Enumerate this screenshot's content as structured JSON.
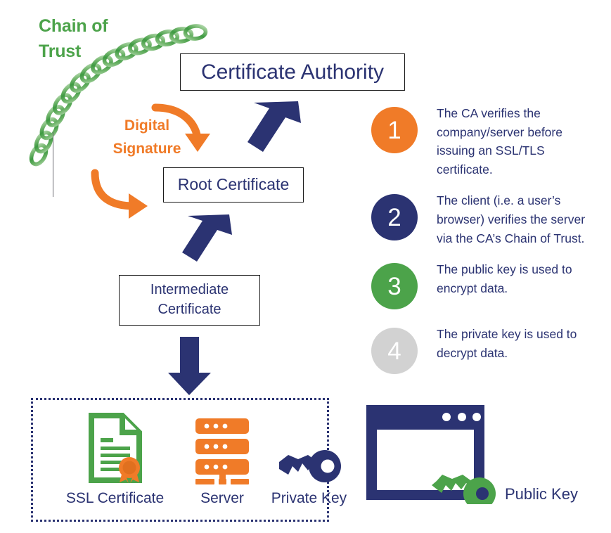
{
  "colors": {
    "navy": "#2B3372",
    "orange": "#F07B28",
    "green": "#4CA34A",
    "gray": "#D2D2D2",
    "white": "#FFFFFF",
    "box_border": "#1A1A1A",
    "rule": "#6B6B72"
  },
  "chain": {
    "label_line1": "Chain of",
    "label_line2": "Trust",
    "icon": "chain-links-icon"
  },
  "digital_signature": {
    "label_line1": "Digital",
    "label_line2": "Signature"
  },
  "nodes": {
    "certificate_authority": "Certificate Authority",
    "root_certificate": "Root Certificate",
    "intermediate_certificate_line1": "Intermediate",
    "intermediate_certificate_line2": "Certificate"
  },
  "arrows": [
    {
      "name": "arrow-ca-to-root",
      "style": "diagonal-down-left",
      "color": "#2B3372"
    },
    {
      "name": "arrow-root-to-intermediate",
      "style": "diagonal-down-left",
      "color": "#2B3372"
    },
    {
      "name": "arrow-intermediate-to-assets",
      "style": "straight-down",
      "color": "#2B3372"
    },
    {
      "name": "arrow-signature-upper",
      "style": "curve-right-down",
      "color": "#F07B28"
    },
    {
      "name": "arrow-signature-lower",
      "style": "curve-right-down",
      "color": "#F07B28"
    }
  ],
  "assets": [
    {
      "icon": "ssl-certificate-icon",
      "label": "SSL Certificate"
    },
    {
      "icon": "server-icon",
      "label": "Server"
    },
    {
      "icon": "private-key-icon",
      "label": "Private Key"
    }
  ],
  "browser": {
    "icon": "browser-window-icon",
    "key_icon": "public-key-icon",
    "label": "Public Key",
    "dot_count": 3
  },
  "steps": [
    {
      "number": "1",
      "color": "#F07B28",
      "text": "The CA verifies the company/server before issuing an SSL/TLS certificate."
    },
    {
      "number": "2",
      "color": "#2B3372",
      "text": "The client (i.e. a user’s browser) verifies the server via the CA’s Chain of Trust."
    },
    {
      "number": "3",
      "color": "#4CA34A",
      "text": "The public key is used to encrypt data."
    },
    {
      "number": "4",
      "color": "#D2D2D2",
      "text": "The private key is used to decrypt data."
    }
  ]
}
